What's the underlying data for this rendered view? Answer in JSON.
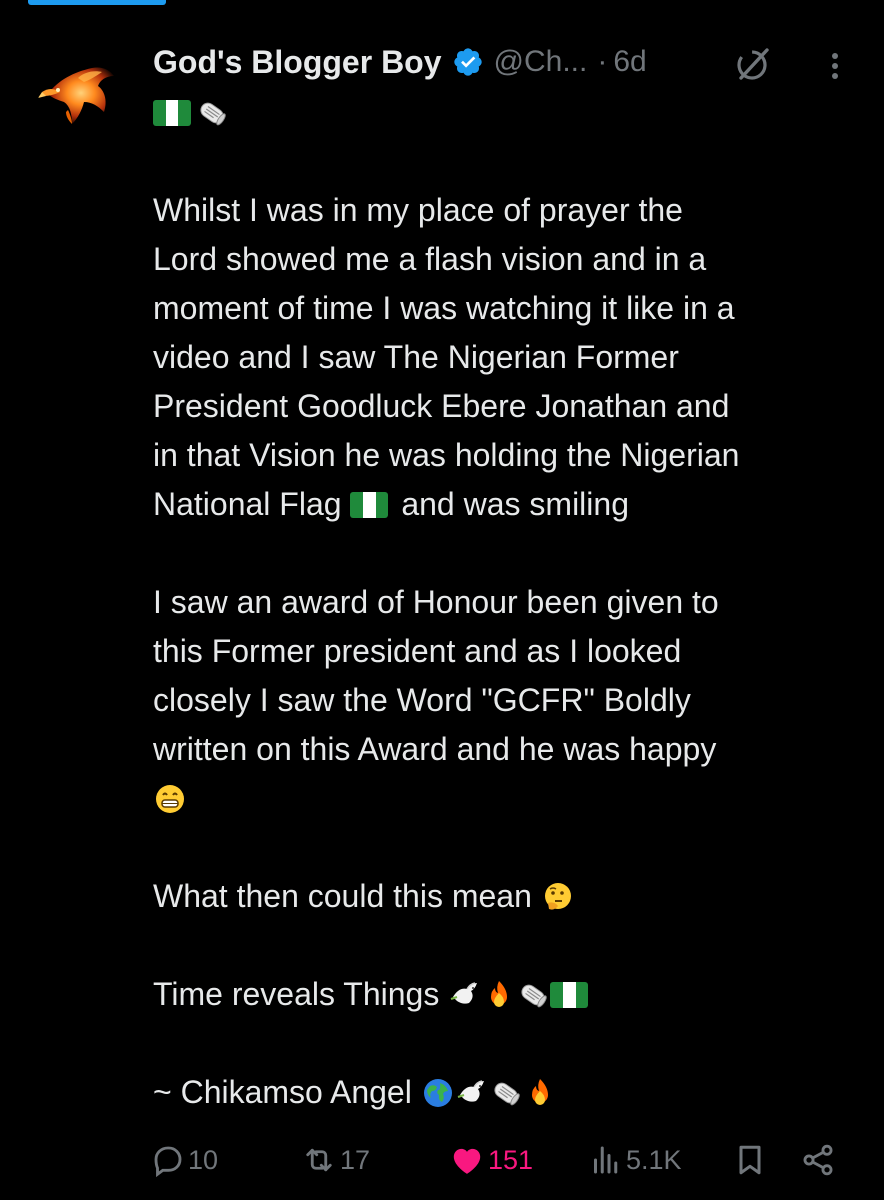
{
  "post": {
    "author": {
      "display_name": "God's Blogger Boy",
      "handle": "@Ch...",
      "separator": "·",
      "time": "6d",
      "verified": true,
      "avatar_icon": "flaming-eagle-avatar"
    },
    "header_icons": [
      "grok-icon",
      "more-options-icon"
    ],
    "lines": [
      {
        "segments": []
      },
      {
        "segments": []
      },
      {
        "segments": [
          {
            "text": "Whilst I was in my place of prayer the"
          }
        ]
      },
      {
        "segments": [
          {
            "text": "Lord showed me a flash vision and in a"
          }
        ]
      },
      {
        "segments": [
          {
            "text": "moment of time I was watching it like in a"
          }
        ]
      },
      {
        "segments": [
          {
            "text": "video and I saw The Nigerian Former"
          }
        ]
      },
      {
        "segments": [
          {
            "text": "President Goodluck Ebere Jonathan and"
          }
        ]
      },
      {
        "segments": [
          {
            "text": "in that Vision he was holding the Nigerian"
          }
        ]
      },
      {
        "segments": [
          {
            "text": "National Flag "
          },
          {
            "emoji": "nigeria-flag"
          },
          {
            "text": " and was smiling"
          }
        ]
      },
      {
        "segments": []
      },
      {
        "segments": [
          {
            "text": "I saw an award of Honour been given to"
          }
        ]
      },
      {
        "segments": [
          {
            "text": "this Former president and as I looked"
          }
        ]
      },
      {
        "segments": [
          {
            "text": "closely I saw the Word \"GCFR\" Boldly"
          }
        ]
      },
      {
        "segments": [
          {
            "text": "written on this Award and he was happy"
          }
        ]
      },
      {
        "segments": [
          {
            "emoji": "grinning-face"
          }
        ]
      },
      {
        "segments": []
      },
      {
        "segments": [
          {
            "text": "What then could this mean "
          },
          {
            "emoji": "thinking-face"
          }
        ]
      },
      {
        "segments": []
      },
      {
        "segments": [
          {
            "text": "Time reveals Things "
          },
          {
            "emoji": "dove"
          },
          {
            "emoji": "fire"
          },
          {
            "emoji": "rolled-newspaper"
          },
          {
            "emoji": "nigeria-flag"
          }
        ]
      },
      {
        "segments": []
      },
      {
        "segments": [
          {
            "text": "~ Chikamso Angel "
          },
          {
            "emoji": "globe"
          },
          {
            "emoji": "dove"
          },
          {
            "emoji": "rolled-newspaper"
          },
          {
            "emoji": "fire"
          }
        ]
      }
    ],
    "first_line_emojis": [
      "nigeria-flag",
      "rolled-newspaper"
    ]
  },
  "actions": {
    "replies": "10",
    "reposts": "17",
    "likes": "151",
    "views": "5.1K",
    "icons": [
      "reply-icon",
      "repost-icon",
      "heart-icon",
      "views-icon",
      "bookmark-icon",
      "share-icon"
    ]
  },
  "colors": {
    "background": "#000000",
    "text": "#e7e9ea",
    "muted": "#71767b",
    "verified": "#1d9bf0",
    "like": "#f91880"
  }
}
